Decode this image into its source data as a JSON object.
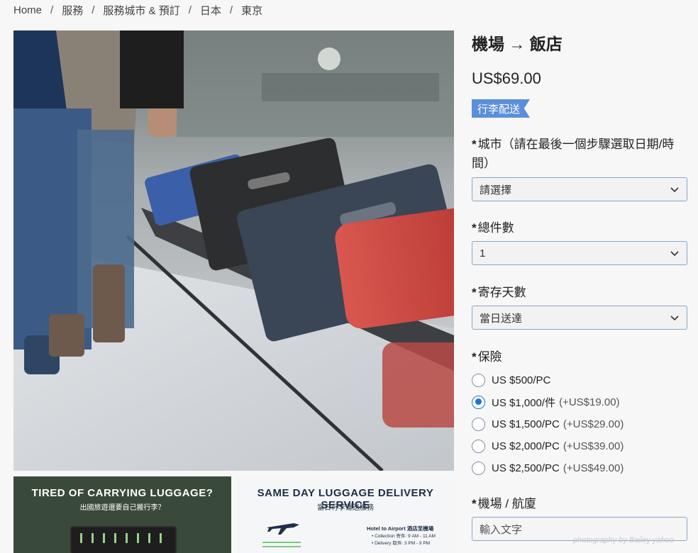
{
  "breadcrumb": [
    "Home",
    "服務",
    "服務城市 & 預訂",
    "日本",
    "東京"
  ],
  "product": {
    "title": "機場 → 飯店",
    "price": "US$69.00",
    "tag": "行李配送"
  },
  "form": {
    "city": {
      "label": "城市（請在最後一個步驟選取日期/時間）",
      "value": "請選擇"
    },
    "pieces": {
      "label": "總件數",
      "value": "1"
    },
    "days": {
      "label": "寄存天數",
      "value": "當日送達"
    },
    "insurance": {
      "label": "保險",
      "options": [
        {
          "text": "US $500/PC",
          "extra": "",
          "selected": false
        },
        {
          "text": "US $1,000/件",
          "extra": "(+US$19.00)",
          "selected": true
        },
        {
          "text": "US $1,500/PC",
          "extra": "(+US$29.00)",
          "selected": false
        },
        {
          "text": "US $2,000/PC",
          "extra": "(+US$39.00)",
          "selected": false
        },
        {
          "text": "US $2,500/PC",
          "extra": "(+US$49.00)",
          "selected": false
        }
      ]
    },
    "flight": {
      "label": "機場 / 航廈",
      "placeholder": "輸入文字"
    },
    "required_mark": "*"
  },
  "thumbnails": {
    "first": {
      "title": "TIRED OF CARRYING LUGGAGE?",
      "subtitle": "出國旅遊還要自己搬行李？"
    },
    "second": {
      "title": "SAME DAY LUGGAGE DELIVERY SERVICE",
      "subtitle": "當日行李運送服務",
      "small_title": "Hotel to Airport 酒店至機場",
      "bullet1": "• Collection 寄件: 9 AM - 11 AM",
      "bullet2": "• Delivery 取件: 3 PM - 9 PM"
    }
  },
  "watermark": "photography by Bailey yahoo"
}
